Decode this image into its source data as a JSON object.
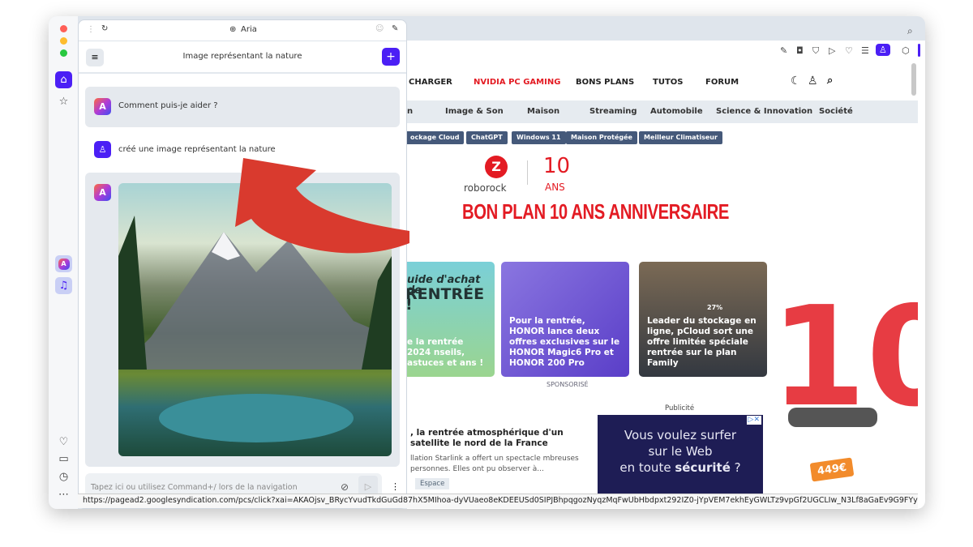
{
  "window": {
    "traffic_lights": [
      "#ff5f57",
      "#febc2e",
      "#28c840"
    ]
  },
  "sidebar": {
    "items": [
      "home-icon",
      "star-icon",
      "aria-icon",
      "music-icon",
      "heart-icon",
      "tabs-icon",
      "history-icon",
      "more-icon"
    ],
    "accent": "#4b1ff5"
  },
  "aria": {
    "tab_title": "Aria",
    "header_title": "Image représentant la nature",
    "messages": [
      {
        "role": "assistant",
        "text": "Comment puis-je aider ?"
      },
      {
        "role": "user",
        "text": "créé une image représentant la nature"
      }
    ],
    "input_placeholder": "Tapez ici ou utilisez Command+/ lors de la navigation"
  },
  "site": {
    "nav": [
      "CHARGER",
      "NVIDIA PC GAMING",
      "BONS PLANS",
      "TUTOS",
      "FORUM"
    ],
    "nav_highlight": "#e31b23",
    "categories": [
      "n",
      "Image & Son",
      "Maison",
      "Streaming",
      "Automobile",
      "Science & Innovation",
      "Société"
    ],
    "tags": [
      "ockage Cloud",
      "ChatGPT",
      "Windows 11",
      "Maison Protégée",
      "Meilleur Climatiseur"
    ],
    "banner": {
      "brand": "roborock",
      "badge_number": "10",
      "badge_text": "ANS",
      "headline": "BON PLAN 10 ANS ANNIVERSAIRE",
      "price": "449€"
    },
    "cards": [
      {
        "kicker": "uide d'achat de",
        "big": "RENTRÉE !",
        "title": "e la rentrée 2024 nseils, astuces et ans !"
      },
      {
        "title": "Pour la rentrée, HONOR lance deux offres exclusives sur le HONOR Magic6 Pro et HONOR 200 Pro"
      },
      {
        "title": "Leader du stockage en ligne, pCloud sort une offre limitée spéciale rentrée sur le plan Family",
        "progress": "27%"
      }
    ],
    "sponsored": "SPONSORISÉ",
    "ad_label": "Publicité",
    "ad": {
      "line1": "Vous voulez surfer",
      "line2": "sur le Web",
      "line3a": "en toute ",
      "line3b": "sécurité",
      "line3c": " ?"
    },
    "article": {
      "title": ", la rentrée atmosphérique d'un satellite le nord de la France",
      "excerpt": "llation Starlink a offert un spectacle mbreuses personnes. Elles ont pu observer à...",
      "tag": "Espace"
    }
  },
  "status_url": "https://pagead2.googlesyndication.com/pcs/click?xai=AKAOjsv_BRycYvudTkdGuGd87hX5MIhoa-dyVUaeo8eKDEEUSd0SIPJBhpqgozNyqzMqFwUbHbdpxt292IZ0-jYpVEM7ekhEyGWLTz9vpGf2UGCLIw_N3Lf8aGaEv9G9FYyZ5GKr..."
}
